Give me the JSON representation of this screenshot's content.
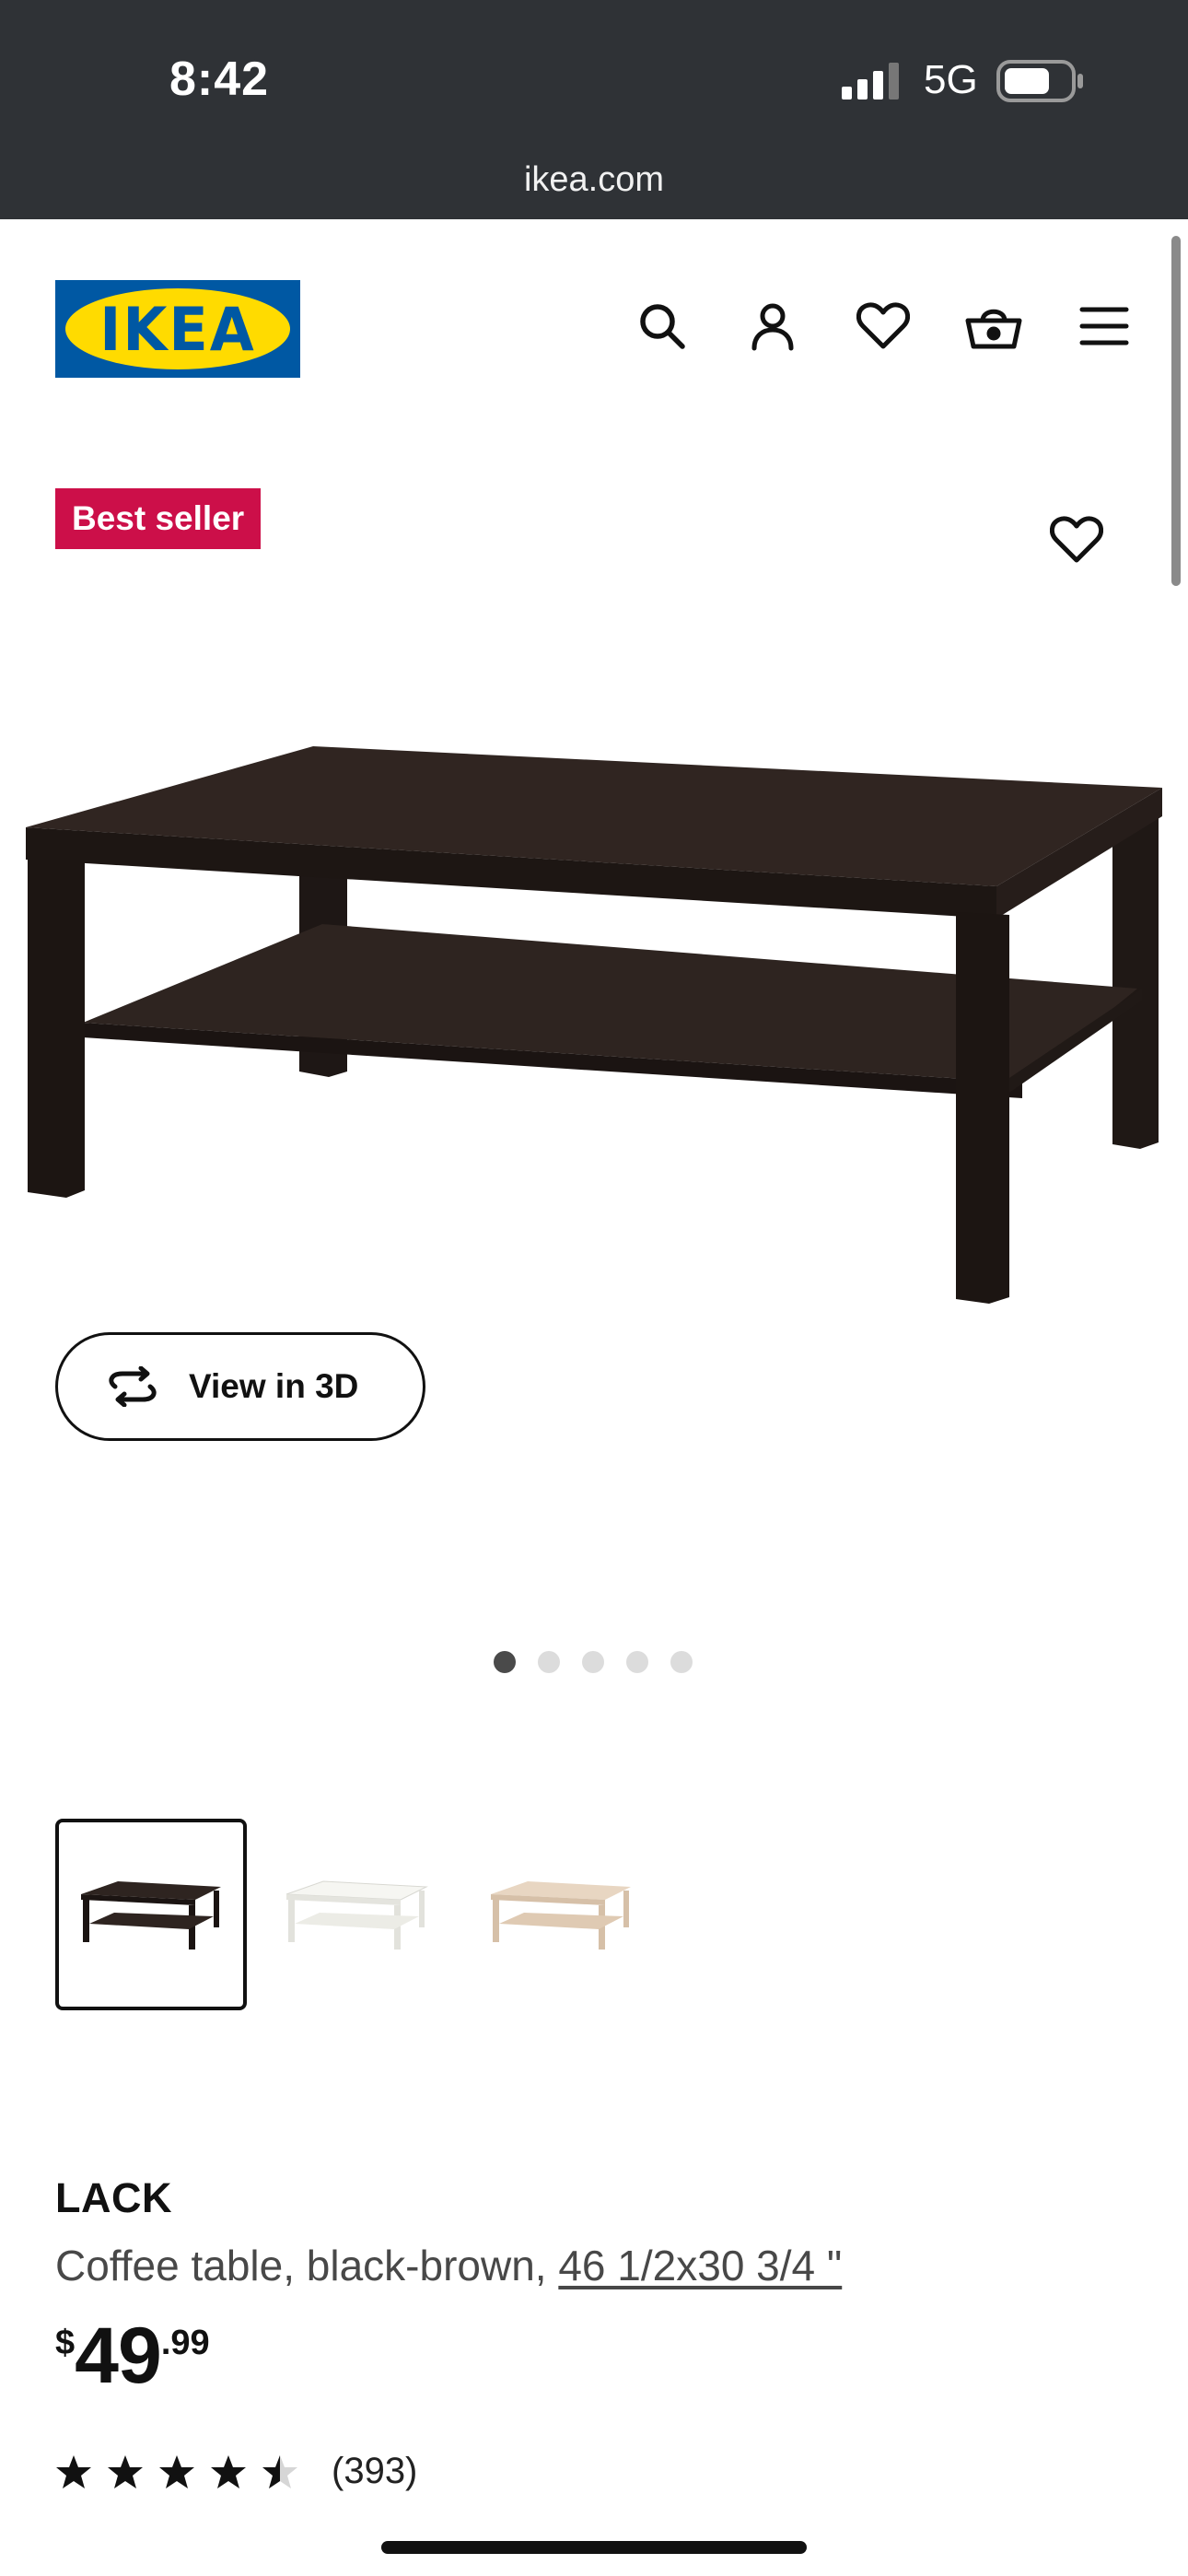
{
  "status_bar": {
    "time": "8:42",
    "network": "5G",
    "icons": [
      "signal-bars-icon",
      "battery-icon"
    ]
  },
  "browser": {
    "url": "ikea.com"
  },
  "header": {
    "logo_text": "IKEA",
    "brand_colors": {
      "blue": "#0058a3",
      "yellow": "#ffdb00"
    },
    "icons": [
      "search-icon",
      "account-icon",
      "heart-icon",
      "basket-icon",
      "menu-icon"
    ]
  },
  "product": {
    "badge": "Best seller",
    "badge_color": "#cc0f49",
    "view_3d_label": "View in 3D",
    "carousel": {
      "total": 5,
      "active": 1
    },
    "variants": [
      {
        "name": "black-brown",
        "selected": true
      },
      {
        "name": "white",
        "selected": false
      },
      {
        "name": "white stained oak effect",
        "selected": false
      }
    ],
    "name": "LACK",
    "desc_prefix": "Coffee table, black-brown, ",
    "size": "46 1/2x30 3/4 \"",
    "price": {
      "currency": "$",
      "integer": "49",
      "decimal": ".99"
    },
    "rating": {
      "value": 4.5,
      "max": 5,
      "count": "(393)"
    }
  }
}
